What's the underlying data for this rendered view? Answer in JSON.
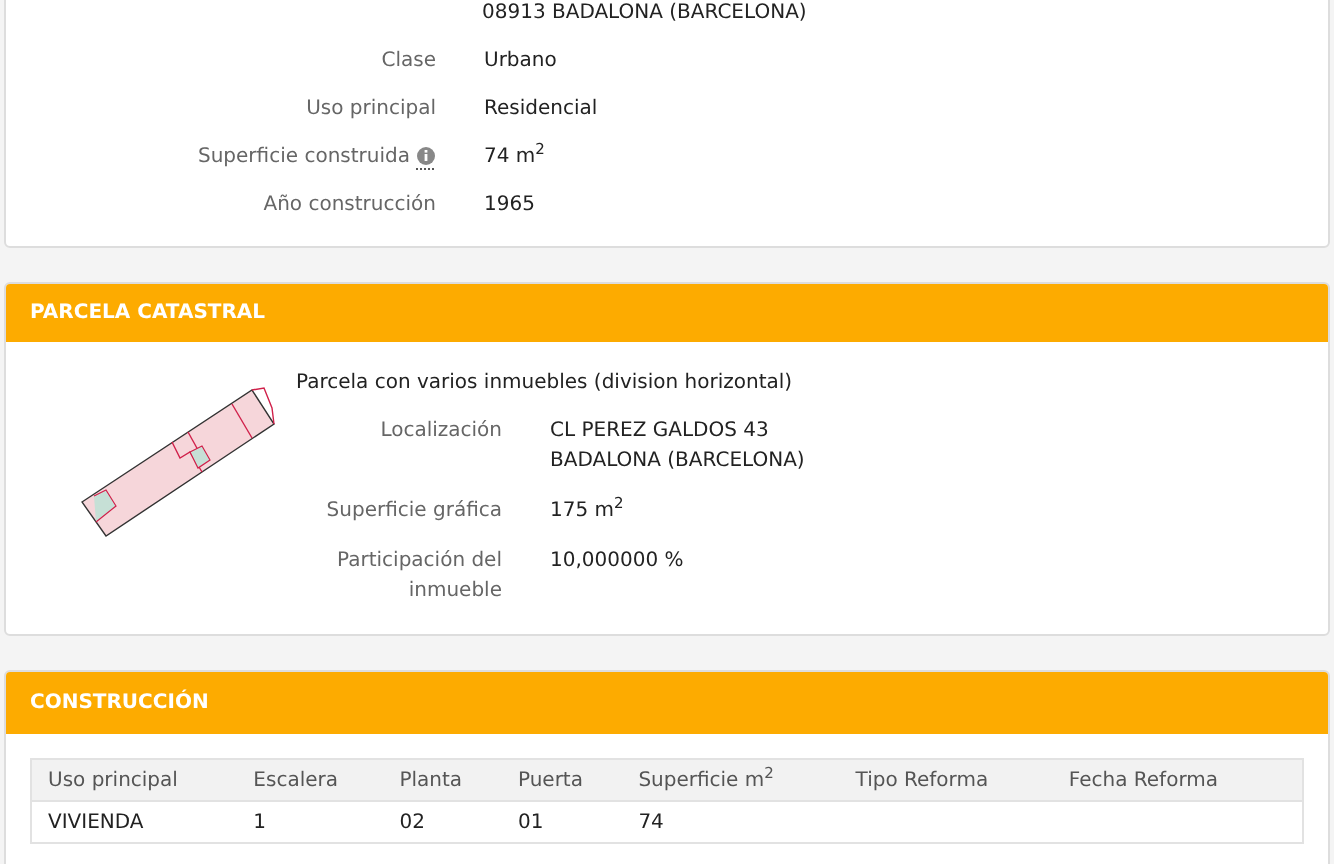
{
  "inmueble": {
    "address_line": "08913 BADALONA (BARCELONA)",
    "fields": [
      {
        "label": "Clase",
        "value": "Urbano",
        "info": false
      },
      {
        "label": "Uso principal",
        "value": "Residencial",
        "info": false
      },
      {
        "label": "Superficie construida",
        "value": "74 m$^{2}$",
        "info": true
      },
      {
        "label": "Año construcción",
        "value": "1965",
        "info": false
      }
    ]
  },
  "parcela": {
    "title": "PARCELA CATASTRAL",
    "description": "Parcela con varios inmuebles (division horizontal)",
    "fields": [
      {
        "label": "Localización",
        "value_lines": [
          "CL PEREZ GALDOS 43",
          "BADALONA (BARCELONA)"
        ]
      },
      {
        "label": "Superficie gráfica",
        "value_lines": [
          "175 m$^{2}$"
        ]
      },
      {
        "label": "Participación del inmueble",
        "value_lines": [
          "10,000000 %"
        ]
      }
    ]
  },
  "construccion": {
    "title": "CONSTRUCCIÓN",
    "table": {
      "columns": [
        "Uso principal",
        "Escalera",
        "Planta",
        "Puerta",
        "Superficie m$^{2}$",
        "Tipo Reforma",
        "Fecha Reforma"
      ],
      "rows": [
        [
          "VIVIENDA",
          "1",
          "02",
          "01",
          "74",
          "",
          ""
        ]
      ]
    }
  }
}
